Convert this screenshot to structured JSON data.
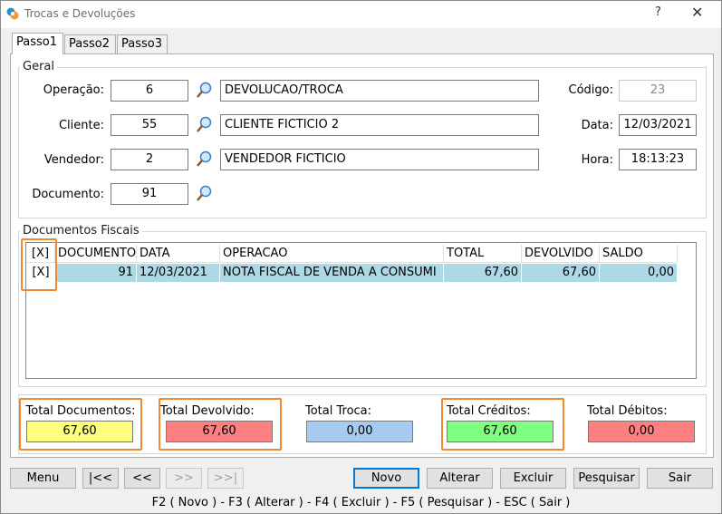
{
  "window": {
    "title": "Trocas e Devoluções",
    "help": "?",
    "close": "✕"
  },
  "tabs": [
    "Passo1",
    "Passo2",
    "Passo3"
  ],
  "geral": {
    "title": "Geral",
    "operacao": {
      "label": "Operação:",
      "code": "6",
      "desc": "DEVOLUCAO/TROCA"
    },
    "cliente": {
      "label": "Cliente:",
      "code": "55",
      "desc": "CLIENTE FICTICIO 2"
    },
    "vendedor": {
      "label": "Vendedor:",
      "code": "2",
      "desc": "VENDEDOR FICTICIO"
    },
    "documento": {
      "label": "Documento:",
      "code": "91"
    },
    "codigo": {
      "label": "Código:",
      "value": "23"
    },
    "data": {
      "label": "Data:",
      "value": "12/03/2021"
    },
    "hora": {
      "label": "Hora:",
      "value": "18:13:23"
    }
  },
  "docs": {
    "title": "Documentos Fiscais",
    "columns": [
      "[X]",
      "DOCUMENTO",
      "DATA",
      "OPERACAO",
      "TOTAL",
      "DEVOLVIDO",
      "SALDO"
    ],
    "rows": [
      [
        "[X]",
        "91",
        "12/03/2021",
        "NOTA FISCAL DE VENDA A CONSUMI",
        "67,60",
        "67,60",
        "0,00"
      ]
    ]
  },
  "totals": {
    "documentos": {
      "label": "Total Documentos:",
      "value": "67,60",
      "color": "#ffff80"
    },
    "devolvido": {
      "label": "Total Devolvido:",
      "value": "67,60",
      "color": "#ff8080"
    },
    "troca": {
      "label": "Total Troca:",
      "value": "0,00",
      "color": "#a6caf0"
    },
    "creditos": {
      "label": "Total Créditos:",
      "value": "67,60",
      "color": "#80ff80"
    },
    "debitos": {
      "label": "Total Débitos:",
      "value": "0,00",
      "color": "#ff8080"
    }
  },
  "buttons": {
    "menu": "Menu",
    "first": "|<<",
    "prev": "<<",
    "next": ">>",
    "last": ">>|",
    "novo": "Novo",
    "alterar": "Alterar",
    "excluir": "Excluir",
    "pesquisar": "Pesquisar",
    "sair": "Sair"
  },
  "shortcuts": "F2 ( Novo )  -  F3 ( Alterar )  -  F4 ( Excluir )  -  F5 ( Pesquisar )  -  ESC ( Sair )",
  "icons": {
    "lookup": "magnifier-icon",
    "app": "app-logo-icon"
  },
  "highlight_color": "#f08a32"
}
